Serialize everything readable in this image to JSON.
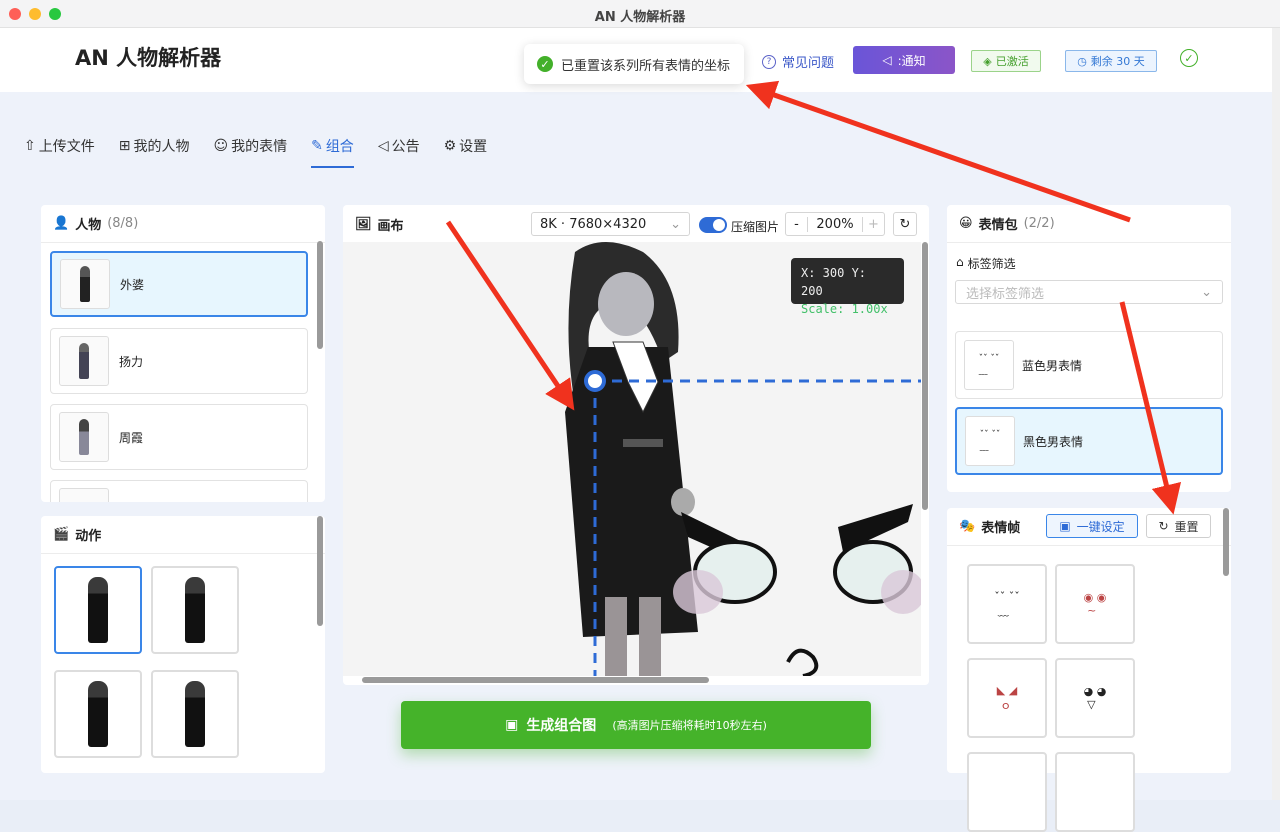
{
  "window": {
    "title": "AN 人物解析器"
  },
  "header": {
    "app_name": "AN 人物解析器",
    "faq": "常见问题",
    "notify": ":通知",
    "activated": "已激活",
    "remaining": "剩余 30 天"
  },
  "toast": {
    "message": "已重置该系列所有表情的坐标"
  },
  "tabs": [
    {
      "label": "上传文件",
      "icon": "upload-icon"
    },
    {
      "label": "我的人物",
      "icon": "grid-icon"
    },
    {
      "label": "我的表情",
      "icon": "smile-icon"
    },
    {
      "label": "组合",
      "icon": "combine-icon"
    },
    {
      "label": "公告",
      "icon": "megaphone-icon"
    },
    {
      "label": "设置",
      "icon": "gear-icon"
    }
  ],
  "characters": {
    "title": "人物",
    "count": "(8/8)",
    "items": [
      "外婆",
      "扬力",
      "周霞"
    ]
  },
  "actions": {
    "title": "动作"
  },
  "canvas": {
    "title": "画布",
    "resolution": "8K · 7680×4320",
    "compress_label": "压缩图片",
    "zoom": "200%",
    "coord_line": "X: 300 Y: 200",
    "scale_line": "Scale: 1.00x"
  },
  "generate": {
    "label": "生成组合图",
    "hint": "(高清图片压缩将耗时10秒左右)"
  },
  "expression_packs": {
    "title": "表情包",
    "count": "(2/2)",
    "filter_label": "标签筛选",
    "filter_placeholder": "选择标签筛选",
    "items": [
      "蓝色男表情",
      "黑色男表情"
    ]
  },
  "expression_frames": {
    "title": "表情帧",
    "set_all": "一键设定",
    "reset": "重置"
  },
  "colors": {
    "accent": "#2e6bd6",
    "green": "#45b32a",
    "toast_ok": "#43b02a",
    "arrow": "#f0321e"
  }
}
